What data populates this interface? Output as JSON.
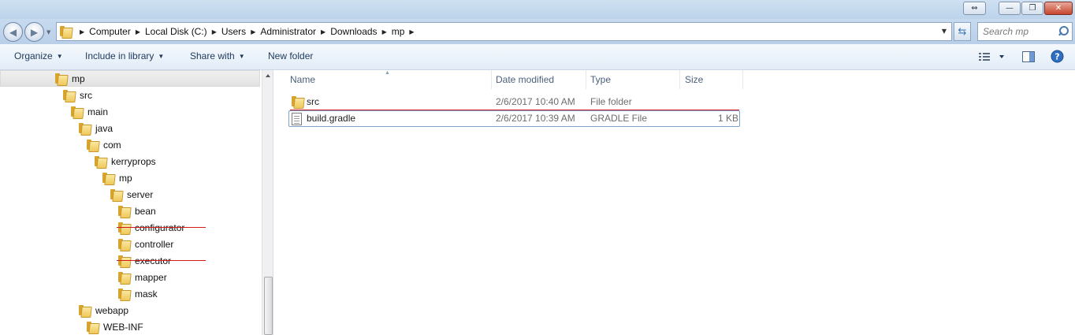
{
  "window": {
    "buttons": {
      "restore_label": "⇔",
      "minimize_label": "—",
      "maximize_label": "❐",
      "close_label": "✕"
    }
  },
  "nav": {
    "back_label": "◀",
    "forward_label": "▶"
  },
  "address": {
    "crumbs": [
      "Computer",
      "Local Disk (C:)",
      "Users",
      "Administrator",
      "Downloads",
      "mp"
    ]
  },
  "search": {
    "placeholder": "Search mp"
  },
  "toolbar": {
    "organize": "Organize",
    "include_in_library": "Include in library",
    "share_with": "Share with",
    "new_folder": "New folder"
  },
  "tree": {
    "items": [
      {
        "label": "mp",
        "struck": false
      },
      {
        "label": "src",
        "struck": false
      },
      {
        "label": "main",
        "struck": false
      },
      {
        "label": "java",
        "struck": false
      },
      {
        "label": "com",
        "struck": false
      },
      {
        "label": "kerryprops",
        "struck": false
      },
      {
        "label": "mp",
        "struck": false
      },
      {
        "label": "server",
        "struck": false
      },
      {
        "label": "bean",
        "struck": false
      },
      {
        "label": "configurator",
        "struck": true
      },
      {
        "label": "controller",
        "struck": false
      },
      {
        "label": "executor",
        "struck": true
      },
      {
        "label": "mapper",
        "struck": false
      },
      {
        "label": "mask",
        "struck": false
      },
      {
        "label": "webapp",
        "struck": false
      },
      {
        "label": "WEB-INF",
        "struck": false
      }
    ]
  },
  "columns": {
    "name": "Name",
    "date": "Date modified",
    "type": "Type",
    "size": "Size"
  },
  "files": [
    {
      "name": "src",
      "date": "2/6/2017 10:40 AM",
      "type": "File folder",
      "size": "",
      "icon": "folder-icon"
    },
    {
      "name": "build.gradle",
      "date": "2/6/2017 10:39 AM",
      "type": "GRADLE File",
      "size": "1 KB",
      "icon": "file-icon"
    }
  ],
  "colors": {
    "strike": "#d21a1a",
    "accent": "#1e395b"
  }
}
